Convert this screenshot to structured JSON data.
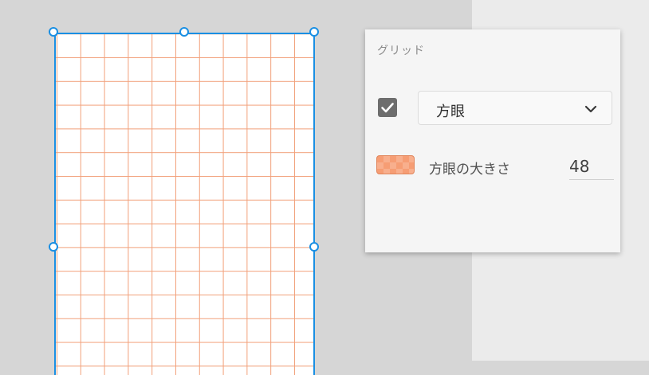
{
  "grid_panel": {
    "title": "グリッド",
    "enabled": true,
    "grid_type": "方眼",
    "grid_size_label": "方眼の大きさ",
    "grid_size_value": "48",
    "grid_color": "#f69d74"
  },
  "colors": {
    "selection": "#1a8fe3",
    "grid_line": "#f2a07a",
    "canvas_bg": "#d6d6d6"
  },
  "icons": {
    "checkbox": "checkmark-icon",
    "dropdown": "chevron-down-icon"
  }
}
